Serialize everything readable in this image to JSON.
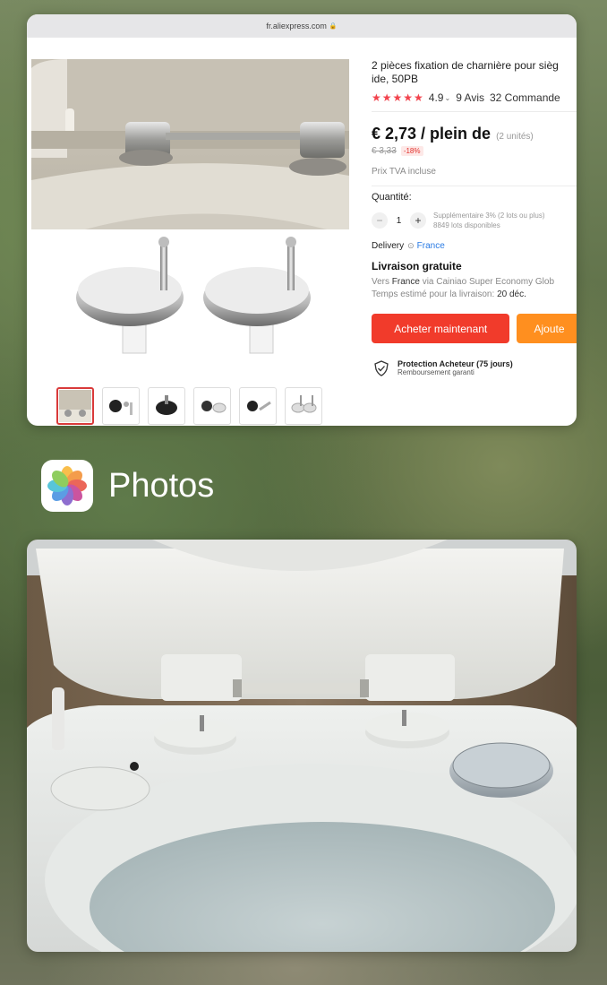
{
  "browser": {
    "url": "fr.aliexpress.com"
  },
  "product": {
    "title_line1": "2 pièces fixation de charnière pour sièg",
    "title_line2": "ide, 50PB",
    "stars": "★★★★★",
    "rating": "4.9",
    "reviews": "9 Avis",
    "orders": "32 Commande",
    "price": "€ 2,73 / plein de",
    "units": "(2 unités)",
    "old_price": "€ 3,33",
    "discount": "-18%",
    "tva": "Prix TVA incluse",
    "quantity_label": "Quantité:",
    "quantity_value": "1",
    "qty_info_line1": "Supplémentaire 3% (2 lots ou plus)",
    "qty_info_line2": "8849 lots disponibles",
    "delivery_label": "Delivery",
    "delivery_country": "France",
    "shipping_title": "Livraison gratuite",
    "shipping_via_prefix": "Vers",
    "shipping_via_country": "France",
    "shipping_via_rest": "via Cainiao Super Economy Glob",
    "shipping_time_prefix": "Temps estimé pour la livraison:",
    "shipping_time_value": "20 déc.",
    "buy_button": "Acheter maintenant",
    "add_button": "Ajoute",
    "protection_title": "Protection Acheteur (75 jours)",
    "protection_sub": "Remboursement garanti"
  },
  "app": {
    "name": "Photos",
    "icon": "photos-app-icon"
  },
  "colors": {
    "accent_red": "#f13b2b",
    "accent_orange": "#ff8f1f",
    "link_blue": "#2a7be4",
    "star_red": "#f2434d"
  }
}
